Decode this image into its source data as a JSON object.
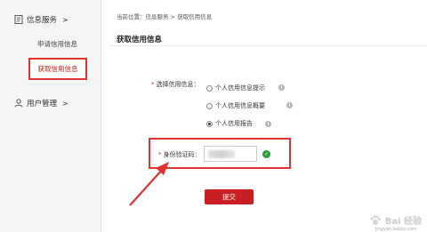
{
  "sidebar": {
    "groups": [
      {
        "label": "信息服务",
        "chevron": ">",
        "icon": "document-icon",
        "items": [
          {
            "label": "申请信用信息"
          },
          {
            "label": "获取信用信息",
            "active": true
          }
        ]
      },
      {
        "label": "用户管理",
        "chevron": ">",
        "icon": "user-icon",
        "items": []
      }
    ]
  },
  "breadcrumb": "当前位置：信息服务 > 获取信用信息",
  "page_title": "获取信用信息",
  "form": {
    "select_label": "选择信用信息：",
    "required_mark": "*",
    "options": [
      {
        "label": "个人信用信息提示",
        "checked": false
      },
      {
        "label": "个人信用信息概要",
        "checked": false
      },
      {
        "label": "个人信用报告",
        "checked": true
      }
    ],
    "id_code_label": "身份验证码：",
    "submit_label": "提交"
  },
  "watermark": {
    "text": "Bai 经验",
    "sub": "jingyan.baidu.com"
  },
  "colors": {
    "accent": "#c81f25",
    "highlight": "#e0322e",
    "success": "#2aa23c"
  }
}
